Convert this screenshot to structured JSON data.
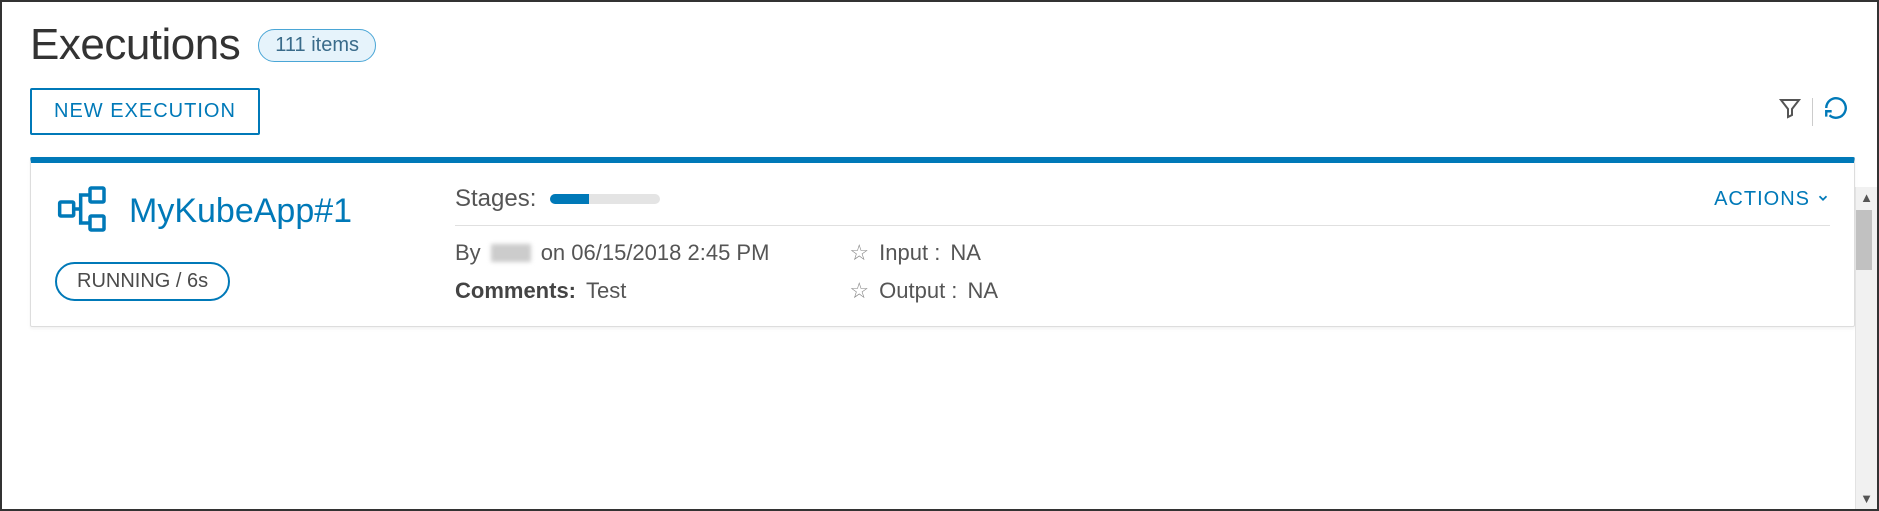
{
  "header": {
    "title": "Executions",
    "count_label": "111 items"
  },
  "toolbar": {
    "new_execution_label": "NEW EXECUTION"
  },
  "execution": {
    "name": "MyKubeApp#1",
    "status_text": "RUNNING / 6s",
    "stages_label": "Stages:",
    "stages_progress_percent": 35,
    "actions_label": "ACTIONS",
    "by_prefix": "By",
    "by_user_redacted": true,
    "by_suffix": "on 06/15/2018 2:45 PM",
    "comments_label": "Comments:",
    "comments_value": "Test",
    "input_label": "Input :",
    "input_value": "NA",
    "output_label": "Output :",
    "output_value": "NA"
  }
}
